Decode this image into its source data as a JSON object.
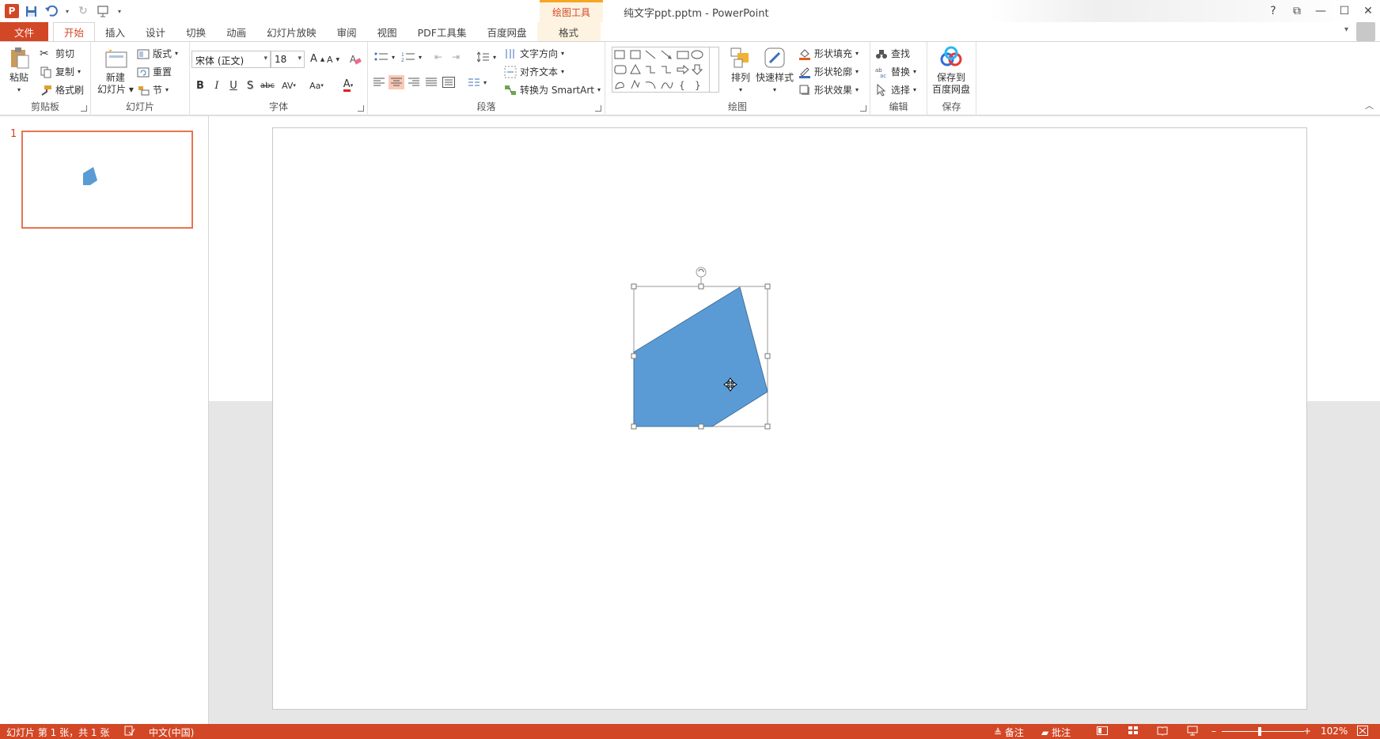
{
  "window": {
    "title": "纯文字ppt.pptm - PowerPoint",
    "context_group": "绘图工具",
    "help": "?",
    "controls": [
      "⧉",
      "—",
      "☐",
      "✕"
    ]
  },
  "tabs": [
    {
      "label": "文件"
    },
    {
      "label": "开始"
    },
    {
      "label": "插入"
    },
    {
      "label": "设计"
    },
    {
      "label": "切换"
    },
    {
      "label": "动画"
    },
    {
      "label": "幻灯片放映"
    },
    {
      "label": "审阅"
    },
    {
      "label": "视图"
    },
    {
      "label": "PDF工具集"
    },
    {
      "label": "百度网盘"
    },
    {
      "label": "格式"
    }
  ],
  "ribbon": {
    "clipboard": {
      "label": "剪贴板",
      "paste": "粘贴",
      "cut": "剪切",
      "copy": "复制",
      "format_painter": "格式刷"
    },
    "slides": {
      "label": "幻灯片",
      "new_slide_1": "新建",
      "new_slide_2": "幻灯片",
      "layout": "版式",
      "reset": "重置",
      "section": "节"
    },
    "font": {
      "label": "字体",
      "font_name": "宋体 (正文)",
      "font_size": "18",
      "bold": "B",
      "italic": "I",
      "underline": "U",
      "shadow": "S",
      "strike": "abc",
      "spacing": "AV",
      "case": "Aa",
      "color": "A"
    },
    "paragraph": {
      "label": "段落",
      "text_direction": "文字方向",
      "align_text": "对齐文本",
      "smartart": "转换为 SmartArt"
    },
    "drawing": {
      "label": "绘图",
      "arrange": "排列",
      "quick_styles": "快速样式",
      "shape_fill": "形状填充",
      "shape_outline": "形状轮廓",
      "shape_effects": "形状效果"
    },
    "editing": {
      "label": "编辑",
      "find": "查找",
      "replace": "替换",
      "select": "选择"
    },
    "save": {
      "label": "保存",
      "save_to_1": "保存到",
      "save_to_2": "百度网盘"
    }
  },
  "thumbnails": [
    {
      "number": "1"
    }
  ],
  "slide": {
    "shape": {
      "fill": "#5b9bd5",
      "kind": "pentagon"
    }
  },
  "status": {
    "slide_info": "幻灯片 第 1 张，共 1 张",
    "language": "中文(中国)",
    "notes": "备注",
    "comments": "批注",
    "zoom": "102%"
  },
  "colors": {
    "accent": "#d24726",
    "shape": "#5b9bd5"
  }
}
